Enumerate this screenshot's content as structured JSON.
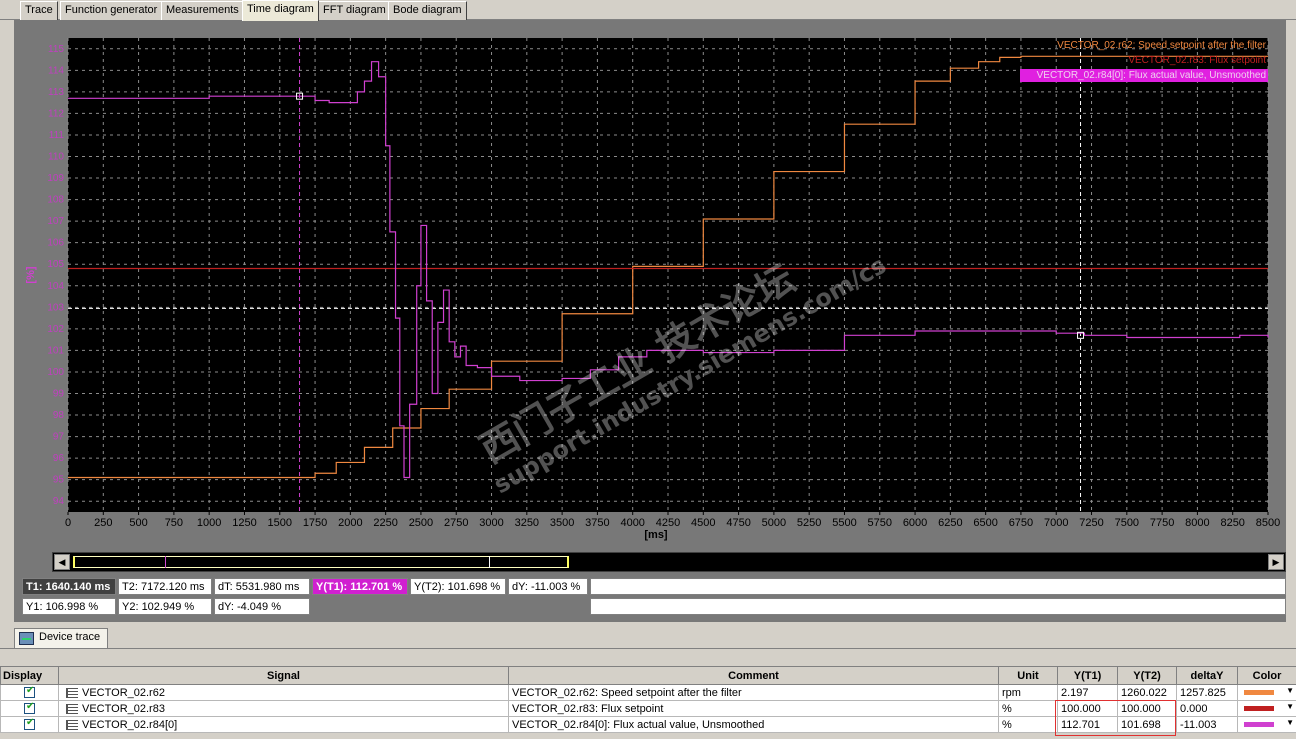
{
  "tabs": [
    "Trace",
    "Function generator",
    "Measurements",
    "Time diagram",
    "FFT diagram",
    "Bode diagram"
  ],
  "active_tab": "Time diagram",
  "chart_data": {
    "type": "line",
    "xlabel": "[ms]",
    "ylabel": "[%]",
    "xlim": [
      0,
      8500
    ],
    "ylim": [
      93.5,
      115.5
    ],
    "x_ticks": [
      0,
      250,
      500,
      750,
      1000,
      1250,
      1500,
      1750,
      2000,
      2250,
      2500,
      2750,
      3000,
      3250,
      3500,
      3750,
      4000,
      4250,
      4500,
      4750,
      5000,
      5250,
      5500,
      5750,
      6000,
      6250,
      6500,
      6750,
      7000,
      7250,
      7500,
      7750,
      8000,
      8250,
      8500
    ],
    "y_ticks": [
      94,
      95,
      96,
      97,
      98,
      99,
      100,
      101,
      102,
      103,
      104,
      105,
      106,
      107,
      108,
      109,
      110,
      111,
      112,
      113,
      114,
      115
    ],
    "grid": true,
    "legend_placement": "top-right",
    "series": [
      {
        "name": "VECTOR_02.r62: Speed setpoint after the filter",
        "color": "#f08840",
        "x": [
          0,
          1640,
          1750,
          1900,
          2100,
          2300,
          2500,
          2700,
          3000,
          3500,
          4000,
          4500,
          5000,
          5500,
          6000,
          6250,
          6450,
          6600,
          6750,
          8500
        ],
        "y": [
          95.1,
          95.1,
          95.3,
          95.8,
          96.5,
          97.4,
          98.3,
          99.2,
          100.5,
          102.7,
          104.9,
          107.1,
          109.3,
          111.5,
          113.5,
          114.1,
          114.4,
          114.6,
          114.65,
          114.65
        ]
      },
      {
        "name": "VECTOR_02.r83: Flux setpoint",
        "color": "#c02020",
        "x": [
          0,
          8500
        ],
        "y": [
          104.8,
          104.8
        ]
      },
      {
        "name": "VECTOR_02.r84[0]: Flux actual value, Unsmoothed",
        "color": "#d040d0",
        "x": [
          0,
          500,
          1000,
          1640,
          1750,
          1850,
          1950,
          2050,
          2100,
          2150,
          2200,
          2250,
          2280,
          2320,
          2350,
          2380,
          2420,
          2470,
          2500,
          2540,
          2580,
          2620,
          2660,
          2700,
          2740,
          2780,
          2820,
          2900,
          3000,
          3200,
          3500,
          3700,
          3900,
          4100,
          4500,
          5000,
          5500,
          6000,
          6500,
          7000,
          7200,
          7500,
          8000,
          8300,
          8500
        ],
        "y": [
          112.7,
          112.7,
          112.8,
          112.8,
          112.6,
          112.5,
          112.5,
          113.0,
          113.5,
          114.4,
          113.7,
          110.5,
          106.5,
          102.5,
          97.5,
          95.1,
          98.5,
          104.0,
          106.8,
          103.3,
          99.0,
          102.3,
          103.8,
          101.4,
          100.7,
          101.2,
          100.3,
          100.2,
          99.8,
          99.6,
          99.7,
          100.1,
          100.7,
          101.0,
          100.9,
          101.0,
          101.7,
          101.9,
          101.9,
          101.8,
          101.7,
          101.6,
          101.6,
          101.7,
          101.6
        ]
      }
    ],
    "cursors": {
      "t1_ms": 1640.14,
      "t2_ms": 7172.12,
      "y1": 106.998,
      "y2": 102.949
    }
  },
  "watermark": [
    "西门子工业 技术论坛",
    "support.industry.siemens.com/cs"
  ],
  "readouts": {
    "t1": "T1: 1640.140 ms",
    "t2": "T2: 7172.120 ms",
    "dt": "dT: 5531.980 ms",
    "yt1": "Y(T1): 112.701 %",
    "yt2": "Y(T2): 101.698 %",
    "dy_t": "dY: -11.003 %",
    "y1": "Y1: 106.998 %",
    "y2": "Y2: 102.949 %",
    "dy": "dY: -4.049 %"
  },
  "device_tab": "Device trace",
  "table": {
    "headers": [
      "Display",
      "Signal",
      "Comment",
      "Unit",
      "Y(T1)",
      "Y(T2)",
      "deltaY",
      "Color"
    ],
    "rows": [
      {
        "signal": "VECTOR_02.r62",
        "comment": "VECTOR_02.r62: Speed setpoint after the filter",
        "unit": "rpm",
        "yt1": "2.197",
        "yt2": "1260.022",
        "delta": "1257.825",
        "color": "#f08840"
      },
      {
        "signal": "VECTOR_02.r83",
        "comment": "VECTOR_02.r83: Flux setpoint",
        "unit": "%",
        "yt1": "100.000",
        "yt2": "100.000",
        "delta": "0.000",
        "color": "#c02020"
      },
      {
        "signal": "VECTOR_02.r84[0]",
        "comment": "VECTOR_02.r84[0]: Flux actual value, Unsmoothed",
        "unit": "%",
        "yt1": "112.701",
        "yt2": "101.698",
        "delta": "-11.003",
        "color": "#d040d0"
      }
    ]
  }
}
